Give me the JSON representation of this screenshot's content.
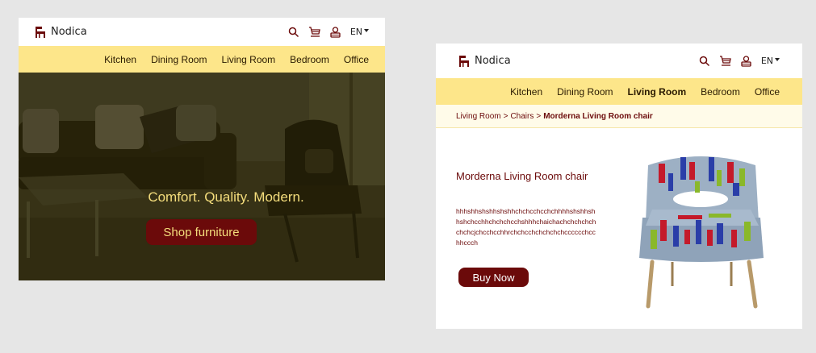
{
  "home": {
    "logo_text": "Nodica",
    "header_icons": [
      "search-icon",
      "cart-icon",
      "user-icon"
    ],
    "language": "EN",
    "nav": [
      {
        "label": "Kitchen",
        "active": false
      },
      {
        "label": "Dining Room",
        "active": false
      },
      {
        "label": "Living Room",
        "active": false
      },
      {
        "label": "Bedroom",
        "active": false
      },
      {
        "label": "Office",
        "active": false
      }
    ],
    "hero": {
      "tagline": "Comfort. Quality. Modern.",
      "cta_label": "Shop furniture"
    }
  },
  "product": {
    "logo_text": "Nodica",
    "header_icons": [
      "search-icon",
      "cart-icon",
      "user-icon"
    ],
    "language": "EN",
    "nav": [
      {
        "label": "Kitchen",
        "active": false
      },
      {
        "label": "Dining Room",
        "active": false
      },
      {
        "label": "Living Room",
        "active": true
      },
      {
        "label": "Bedroom",
        "active": false
      },
      {
        "label": "Office",
        "active": false
      }
    ],
    "breadcrumb": {
      "first": "Living Room",
      "separator": ">",
      "second": "Chairs",
      "current": "Morderna Living Room chair"
    },
    "title": "Morderna Living Room chair",
    "description": "hhhshhshshhshshhchchcchcchchhhhshshhshhshchcchhchchchcchshhhchaichachchchchchchchcjchcchcchhrchchcchchchchchcccccchcchhccch",
    "buy_label": "Buy Now"
  },
  "colors": {
    "nav_bg": "#fde68a",
    "brand_red": "#6b0a0a",
    "tagline": "#f4dd7c",
    "page_bg": "#e6e6e6"
  }
}
